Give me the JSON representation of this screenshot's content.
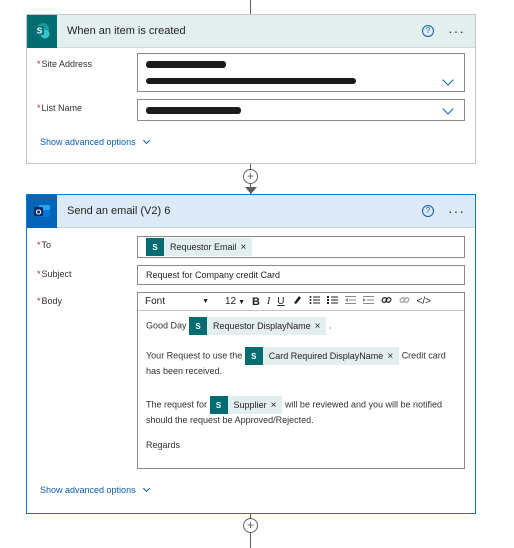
{
  "trigger": {
    "title": "When an item is created",
    "help": "?",
    "more": "···",
    "site_address_label": "Site Address",
    "list_name_label": "List Name",
    "advanced": "Show advanced options"
  },
  "action": {
    "title": "Send an email (V2) 6",
    "help": "?",
    "more": "···",
    "to_label": "To",
    "to_token": "Requestor Email",
    "subject_label": "Subject",
    "subject_value": "Request for Company credit Card",
    "body_label": "Body",
    "toolbar": {
      "font": "Font",
      "size": "12",
      "bold": "B",
      "italic": "I",
      "underline": "U",
      "code": "</>"
    },
    "body": {
      "greeting": "Good Day",
      "token_display_name": "Requestor DisplayName",
      "after_greeting": ".",
      "request_prefix": "Your Request to use the",
      "token_card": "Card Required DisplayName",
      "request_suffix": "Credit card has been received.",
      "review_prefix": "The request for",
      "token_supplier": "Supplier",
      "review_suffix": "will be reviewed and you will be notified should the request be Approved/Rejected.",
      "regards": "Regards"
    },
    "advanced": "Show advanced options"
  },
  "icons": {
    "sharepoint": "sharepoint-icon",
    "outlook": "outlook-icon"
  },
  "colors": {
    "sharepoint": "#036c70",
    "outlook": "#0364b8",
    "link": "#0b5cad",
    "required": "#a4262c"
  }
}
